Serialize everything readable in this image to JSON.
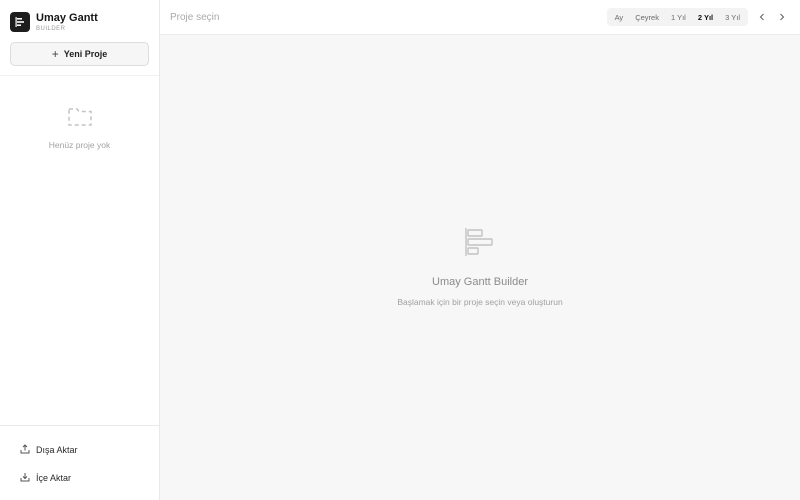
{
  "brand": {
    "title": "Umay Gantt",
    "subtitle": "BUILDER"
  },
  "sidebar": {
    "new_project_label": "Yeni Proje",
    "empty_text": "Henüz proje yok",
    "footer": {
      "export_label": "Dışa Aktar",
      "import_label": "İçe Aktar"
    }
  },
  "topbar": {
    "project_placeholder": "Proje seçin",
    "zoom_options": [
      "Ay",
      "Çeyrek",
      "1 Yıl",
      "2 Yıl",
      "3 Yıl"
    ],
    "zoom_selected": "2 Yıl"
  },
  "main": {
    "empty_title": "Umay Gantt Builder",
    "empty_subtitle": "Başlamak için bir proje seçin veya oluşturun"
  },
  "icons": {
    "brand": "gantt-logo-icon",
    "new_project": "plus-icon",
    "empty_projects": "dashed-folder-icon",
    "export": "upload-icon",
    "import": "download-icon",
    "prev": "chevron-left-icon",
    "next": "chevron-right-icon",
    "placeholder": "gantt-chart-icon"
  }
}
